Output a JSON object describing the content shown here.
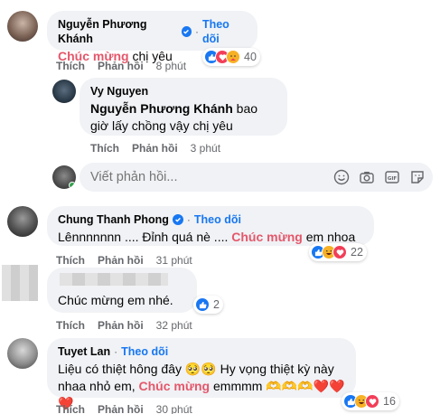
{
  "comments": {
    "c1": {
      "author": "Nguyễn Phương Khánh",
      "follow": "Theo dõi",
      "text_hl": "Chúc mừng",
      "text_rest": " chị yêu",
      "like": "Thích",
      "reply": "Phản hồi",
      "time": "8 phút",
      "reaction_count": "40"
    },
    "c2": {
      "author": "Vy Nguyen",
      "mention": "Nguyễn Phương Khánh",
      "text_rest": " bao giờ lấy chồng vậy chị yêu",
      "like": "Thích",
      "reply": "Phản hồi",
      "time": "3 phút"
    },
    "c3": {
      "author": "Chung Thanh Phong",
      "follow": "Theo dõi",
      "text_a": "Lênnnnnnn .... Đỉnh quá nè .... ",
      "text_hl": "Chúc mừng",
      "text_b": " em nhoa",
      "like": "Thích",
      "reply": "Phản hồi",
      "time": "31 phút",
      "reaction_count": "22"
    },
    "c4": {
      "text": "Chúc mừng em nhé.",
      "like": "Thích",
      "reply": "Phản hồi",
      "time": "32 phút",
      "reaction_count": "2"
    },
    "c5": {
      "author": "Tuyet Lan",
      "follow": "Theo dõi",
      "text_a": "Liệu có thiệt hông đây 🥺🥺 Hy vọng thiệt kỳ này nhaa nhỏ em, ",
      "text_hl": "Chúc mừng",
      "text_b": " emmmm 🫶🫶🫶❤️❤️❤️",
      "like": "Thích",
      "reply": "Phản hồi",
      "time": "30 phút",
      "reaction_count": "16"
    }
  },
  "reply_box": {
    "placeholder": "Viết phản hồi..."
  },
  "icons": {
    "emoji": "emoji-icon",
    "camera": "camera-icon",
    "gif": "gif-icon",
    "sticker": "sticker-icon"
  },
  "colors": {
    "accent": "#1877f2",
    "highlight": "#e4576b",
    "bubble": "#f0f2f5",
    "muted": "#65676b"
  }
}
